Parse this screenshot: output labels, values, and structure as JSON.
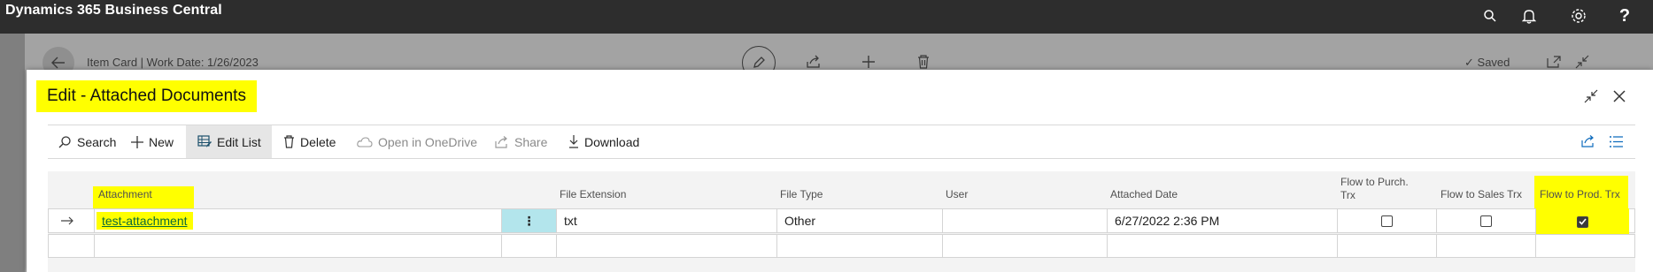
{
  "app": {
    "title": "Dynamics 365 Business Central"
  },
  "topbar_icons": [
    "search-icon",
    "bell-icon",
    "gear-icon",
    "help-icon"
  ],
  "help_glyph": "?",
  "background_page": {
    "title": "Item Card | Work Date: 1/26/2023",
    "saved_label": "Saved"
  },
  "dialog": {
    "title": "Edit - Attached Documents"
  },
  "actions": {
    "search": "Search",
    "new": "New",
    "edit_list": "Edit List",
    "delete": "Delete",
    "open_onedrive": "Open in OneDrive",
    "share": "Share",
    "download": "Download"
  },
  "columns": {
    "attachment": "Attachment",
    "file_extension": "File Extension",
    "file_type": "File Type",
    "user": "User",
    "attached_date": "Attached Date",
    "flow_purch": "Flow to Purch. Trx",
    "flow_sales": "Flow to Sales Trx",
    "flow_prod": "Flow to Prod. Trx"
  },
  "rows": [
    {
      "attachment": "test-attachment",
      "file_extension": "txt",
      "file_type": "Other",
      "user": "",
      "attached_date": "6/27/2022 2:36 PM",
      "flow_purch": false,
      "flow_sales": false,
      "flow_prod": true
    }
  ],
  "colors": {
    "highlight": "#ffff00",
    "topbar": "#2d2d2d",
    "selected_cell": "#b3e5ec"
  }
}
